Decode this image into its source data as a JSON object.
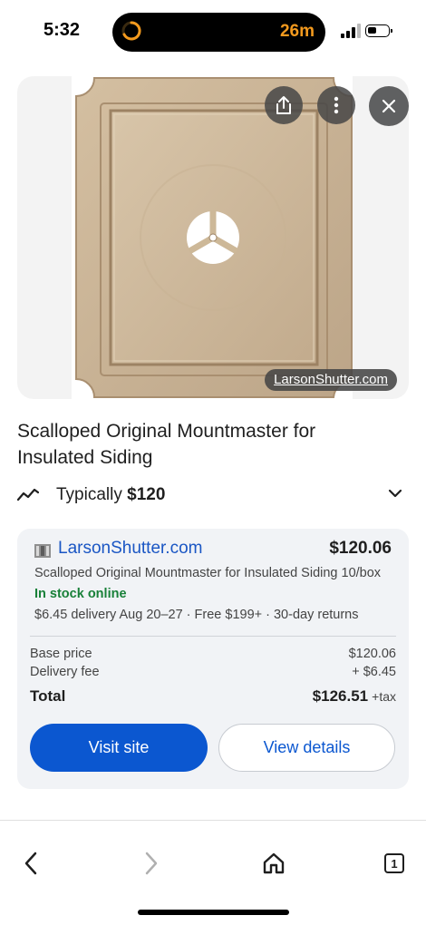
{
  "status_bar": {
    "time": "5:32",
    "timer": "26m"
  },
  "product": {
    "source_label": "LarsonShutter.com",
    "title": "Scalloped Original Mountmaster for Insulated Siding",
    "typical_prefix": "Typically",
    "typical_price": "$120"
  },
  "offer": {
    "merchant": "LarsonShutter.com",
    "price": "$120.06",
    "description": "Scalloped Original Mountmaster for Insulated Siding 10/box",
    "stock": "In stock online",
    "delivery": "$6.45 delivery Aug 20–27 · Free $199+ · 30-day returns",
    "base_price_label": "Base price",
    "base_price_value": "$120.06",
    "delivery_fee_label": "Delivery fee",
    "delivery_fee_value": "+ $6.45",
    "total_label": "Total",
    "total_value": "$126.51",
    "tax_label": "+tax",
    "visit_label": "Visit site",
    "details_label": "View details"
  },
  "nav": {
    "tab_count": "1"
  },
  "colors": {
    "link": "#1a56c4",
    "primary": "#0b57d0",
    "stock": "#188038",
    "timer": "#f39a1e"
  }
}
